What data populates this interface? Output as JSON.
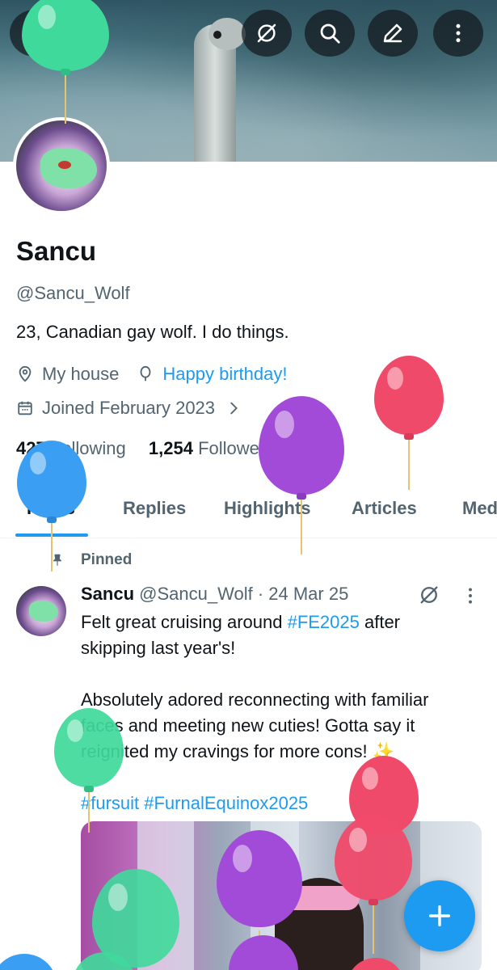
{
  "profile": {
    "name": "Sancu",
    "handle": "@Sancu_Wolf",
    "bio": "23, Canadian gay wolf. I do things.",
    "location": "My house",
    "birthday": "Happy birthday!",
    "joined": "Joined February 2023",
    "following_count": "427",
    "following_label": "Following",
    "followers_count": "1,254",
    "followers_label": "Followers"
  },
  "tabs": [
    "Posts",
    "Replies",
    "Highlights",
    "Articles",
    "Med"
  ],
  "active_tab": "Posts",
  "post": {
    "pinned_label": "Pinned",
    "author_name": "Sancu",
    "author_meta": "@Sancu_Wolf · 24 Mar 25",
    "lines": [
      {
        "text": "Felt great cruising around ",
        "tag": "#FE2025",
        "after": " after"
      },
      {
        "text": "skipping last year's!"
      },
      {
        "text": ""
      },
      {
        "text": "Absolutely adored reconnecting with familiar"
      },
      {
        "text": "faces and meeting new cuties! Gotta say it"
      },
      {
        "text": "reignited my cravings for more cons! ✨"
      },
      {
        "text": ""
      },
      {
        "tag": "#fursuit #FurnalEquinox2025"
      }
    ]
  },
  "icons": {
    "back": "arrow-left-icon",
    "grok": "grok-icon",
    "search": "search-icon",
    "edit": "compose-icon",
    "more": "more-vertical-icon",
    "location": "location-pin-icon",
    "birthday": "balloon-icon",
    "joined": "calendar-icon",
    "pin": "pin-icon",
    "fab": "plus-icon"
  },
  "colors": {
    "accent": "#1d9bf0",
    "text": "#0f1419",
    "muted": "#536471",
    "balloon_green": "#3fd99b",
    "balloon_pink": "#f04a6a",
    "balloon_purple": "#a24bd8",
    "balloon_blue": "#3a9ff2"
  }
}
